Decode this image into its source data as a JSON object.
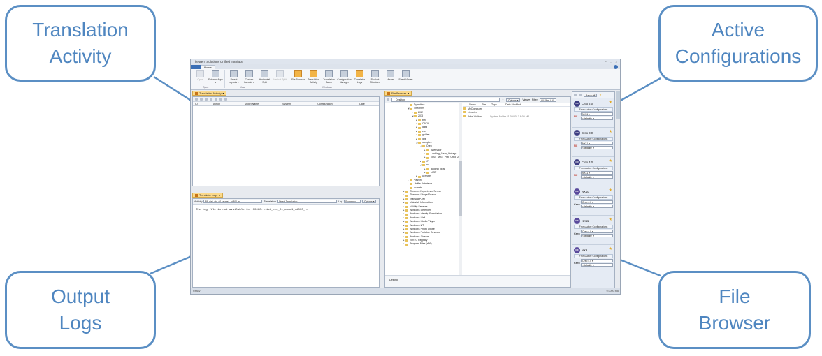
{
  "callouts": {
    "translation_activity": [
      "Translation",
      "Activity"
    ],
    "active_configurations": [
      "Active",
      "Configurations"
    ],
    "output_logs": [
      "Output",
      "Logs"
    ],
    "file_browser": [
      "File",
      "Browser"
    ]
  },
  "app": {
    "title": "Theorem Solutions Unified Interface",
    "file_tab": "",
    "home_tab": "Home",
    "window_controls": [
      "–",
      "□",
      "×"
    ],
    "ribbon": {
      "open": {
        "buttons": [
          {
            "label": "Open",
            "disabled": true
          },
          {
            "label": "External Apps ▾"
          }
        ],
        "group": "Open"
      },
      "view": {
        "buttons": [
          {
            "label": "Preset Layouts ▾"
          },
          {
            "label": "Custom Layouts ▾"
          },
          {
            "label": "Horizontal Split"
          },
          {
            "label": "Vertical Split",
            "disabled": true
          }
        ],
        "group": "View"
      },
      "windows": {
        "buttons": [
          {
            "label": "File Browser",
            "active": true
          },
          {
            "label": "Translation Activity",
            "active": true
          },
          {
            "label": "Translation Batch"
          },
          {
            "label": "Configuration Manager"
          },
          {
            "label": "Translator Logs",
            "active": true
          },
          {
            "label": "Product Structure"
          },
          {
            "label": "Viewer"
          },
          {
            "label": "Event Viewer"
          }
        ],
        "group": "Windows"
      }
    },
    "translation_activity": {
      "tab_label": "Translation Activity",
      "columns": [
        "ID",
        "Action",
        "Model Name",
        "System",
        "Configuration",
        "Date"
      ]
    },
    "translator_logs": {
      "tab_label": "Translator Logs",
      "activity_label": "Activity",
      "activity_value": "88- nist_ctc_01_asme1_rd800_rd",
      "translation_label": "Translation",
      "translation_value": "Direct Translation",
      "log_label": "Log",
      "log_value": "Summary",
      "options_label": "Options ▾",
      "message": "The log file is not available for 00088: nist_ctc_01_asme1_rd800_rd"
    },
    "file_browser": {
      "tab_label": "File Browser",
      "address": "Desktop",
      "options_label": "Options ▾",
      "view_label": "View ▾",
      "filter_label": "Filter",
      "filter_value": "All Files (*.*)",
      "tree": [
        {
          "label": "Symphtro",
          "depth": 1
        },
        {
          "label": "Theorem",
          "depth": 1,
          "open": true
        },
        {
          "label": "20.2",
          "depth": 2
        },
        {
          "label": "20.3",
          "depth": 2,
          "open": true
        },
        {
          "label": "bin",
          "depth": 3
        },
        {
          "label": "CATIA",
          "depth": 3
        },
        {
          "label": "data",
          "depth": 3
        },
        {
          "label": "etc",
          "depth": 3
        },
        {
          "label": "guides",
          "depth": 3
        },
        {
          "label": "libs",
          "depth": 3
        },
        {
          "label": "samples",
          "depth": 3,
          "open": true
        },
        {
          "label": "Creo",
          "depth": 4,
          "open": true
        },
        {
          "label": "Alternator",
          "depth": 5
        },
        {
          "label": "Landing_Gear_Linkage",
          "depth": 5
        },
        {
          "label": "NIST_MBE_PMI_Creo_2",
          "depth": 5
        },
        {
          "label": "JT",
          "depth": 4
        },
        {
          "label": "nx",
          "depth": 4,
          "open": true
        },
        {
          "label": "landing_gear",
          "depth": 5
        },
        {
          "label": "NIST",
          "depth": 5
        },
        {
          "label": "ucreate",
          "depth": 3
        },
        {
          "label": "Passim",
          "depth": 1
        },
        {
          "label": "Unified Interface",
          "depth": 1
        },
        {
          "label": "ucreate",
          "depth": 1
        },
        {
          "label": "Theorem Experience Server",
          "depth": 0
        },
        {
          "label": "Theorem Shape Search",
          "depth": 0
        },
        {
          "label": "TranscatPDM",
          "depth": 0
        },
        {
          "label": "Uninstall Information",
          "depth": 0
        },
        {
          "label": "Validity Sensors",
          "depth": 0
        },
        {
          "label": "Windows Defender",
          "depth": 0
        },
        {
          "label": "Windows Identity Foundation",
          "depth": 0
        },
        {
          "label": "Windows Mail",
          "depth": 0
        },
        {
          "label": "Windows Media Player",
          "depth": 0
        },
        {
          "label": "Windows NT",
          "depth": 0
        },
        {
          "label": "Windows Photo Viewer",
          "depth": 0
        },
        {
          "label": "Windows Portable Devices",
          "depth": 0
        },
        {
          "label": "Windows Sidebar",
          "depth": 0
        },
        {
          "label": "Zero G Registry",
          "depth": 0
        },
        {
          "label": "Program Files (x86)",
          "depth": 0
        }
      ],
      "columns": [
        "Name",
        "Size",
        "Type",
        "Date Modified"
      ],
      "files": [
        {
          "name": "MyComputer",
          "size": "",
          "type": "",
          "date": ""
        },
        {
          "name": "Libraries",
          "size": "",
          "type": "",
          "date": ""
        },
        {
          "name": "John Walton",
          "size": "",
          "type": "System Folder",
          "date": "11/09/2017 8:00 AM"
        }
      ],
      "bottom_label": "Desktop"
    },
    "active_configurations": {
      "batch_label": "Batch off",
      "from_label": "From Active Configurations",
      "cards": [
        {
          "name": "Creo 2.0",
          "logo": "CR",
          "target_label": "NX",
          "target": "NX11",
          "default": "<default>"
        },
        {
          "name": "Creo 3.0",
          "logo": "CR",
          "target_label": "NX",
          "target": "NX11",
          "default": "<default>"
        },
        {
          "name": "Creo 4.0",
          "logo": "CR",
          "target_label": "NX",
          "target": "NX11",
          "default": "<default>"
        },
        {
          "name": "NX10",
          "logo": "NX",
          "target_label": "Creo",
          "target": "Creo 4.0",
          "default": "<default>"
        },
        {
          "name": "NX11",
          "logo": "NX",
          "target_label": "Creo",
          "target": "Creo 4.0",
          "default": "<default>"
        },
        {
          "name": "NX9",
          "logo": "NX",
          "target_label": "Creo",
          "target": "Creo 4.0",
          "default": "<default>"
        }
      ]
    },
    "status_left": "Ready",
    "status_right": "0.0000 MB"
  }
}
